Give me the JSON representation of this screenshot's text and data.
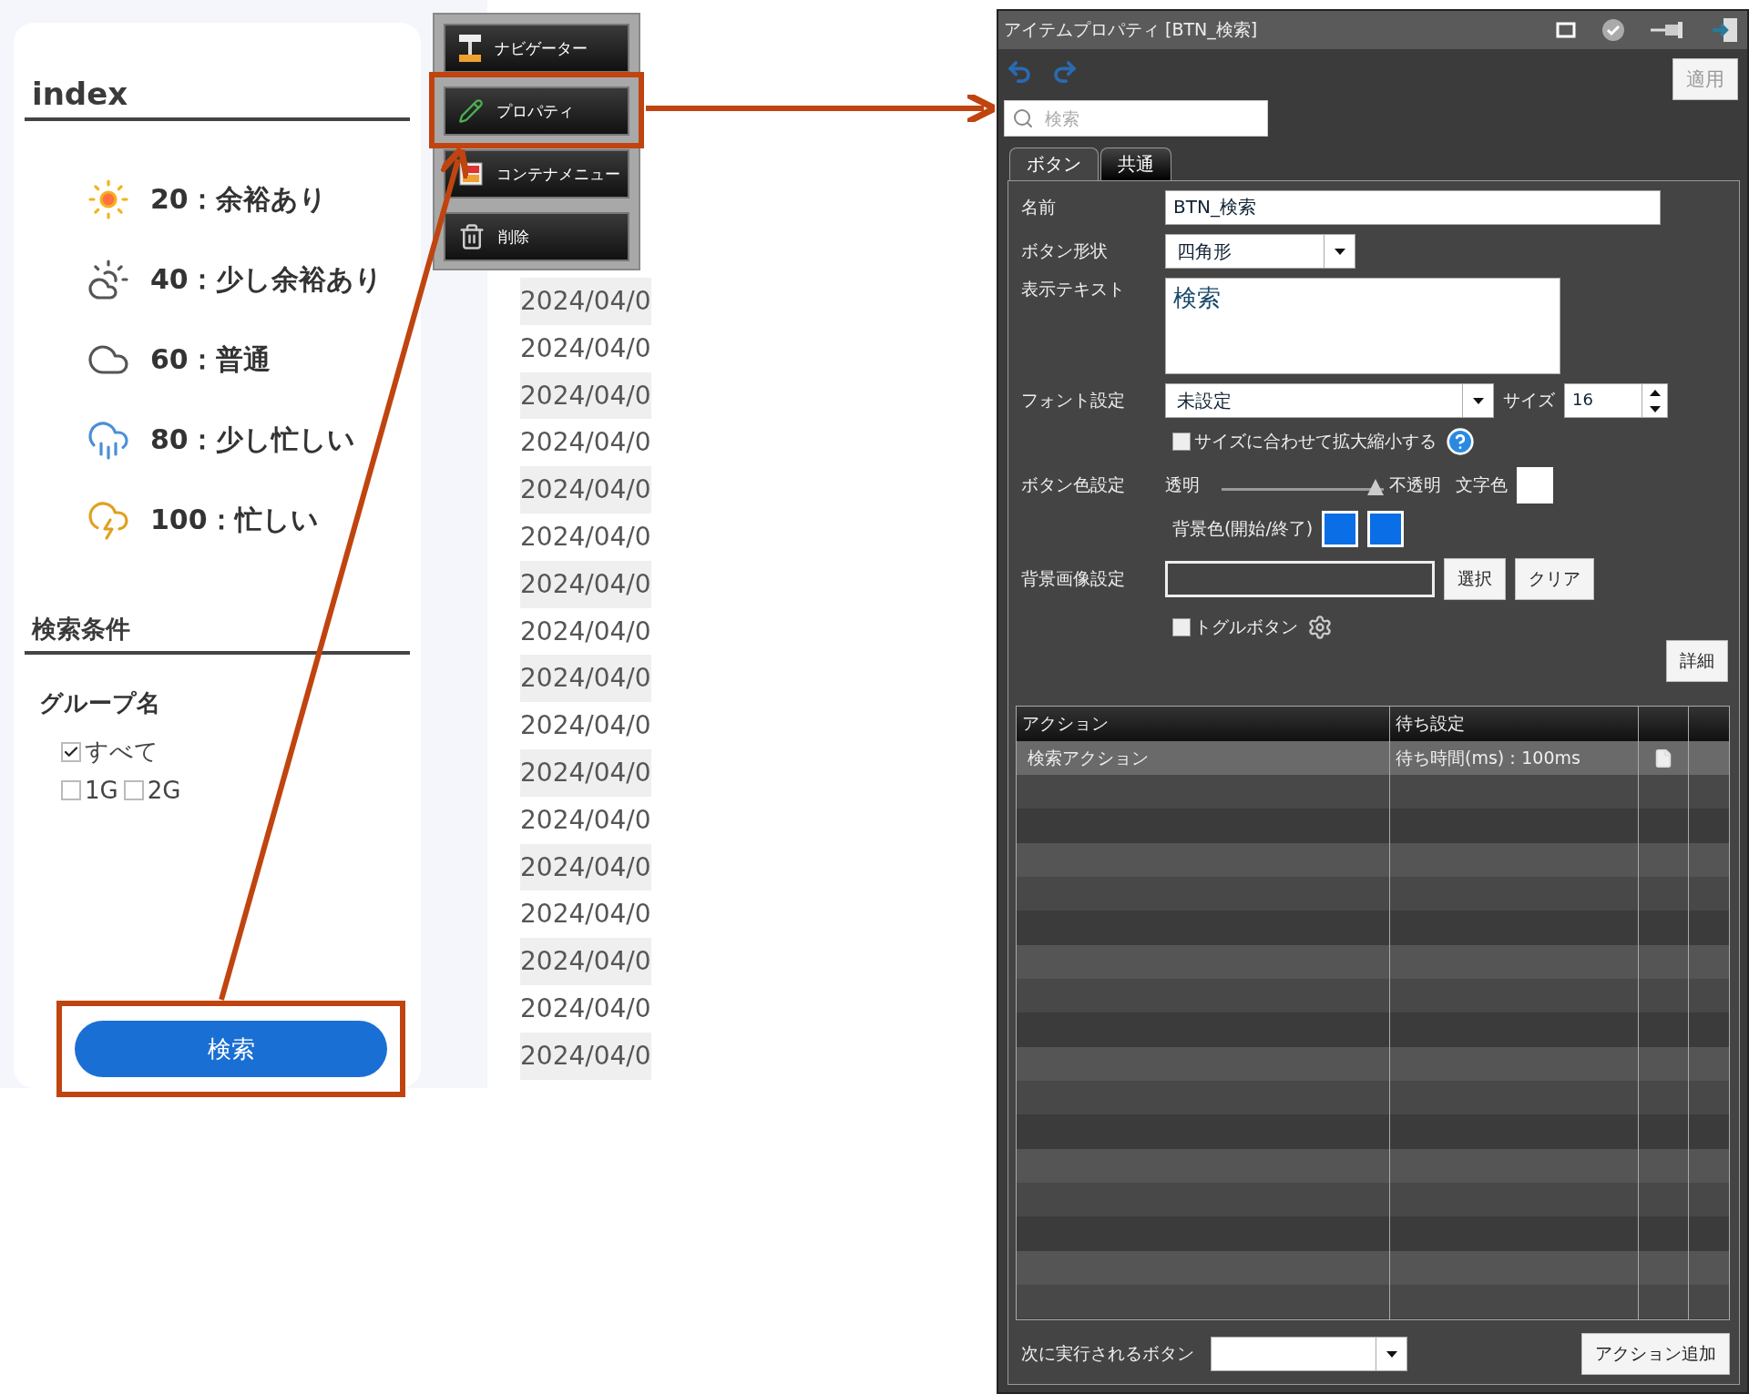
{
  "sidebar": {
    "title": "index",
    "legend": [
      {
        "kind": "sun",
        "label": "20：余裕あり"
      },
      {
        "kind": "sun-cloud",
        "label": "40：少し余裕あり"
      },
      {
        "kind": "cloud",
        "label": "60：普通"
      },
      {
        "kind": "rain",
        "label": "80：少し忙しい"
      },
      {
        "kind": "storm",
        "label": "100：忙しい"
      }
    ],
    "section_title": "検索条件",
    "group_label": "グループ名",
    "checkboxes": [
      {
        "label": "すべて",
        "checked": true
      },
      {
        "label": "1G",
        "checked": false
      },
      {
        "label": "2G",
        "checked": false
      }
    ],
    "search_button": {
      "label": "検索",
      "highlighted": true
    }
  },
  "date_column": {
    "rows": [
      "2024/04/0",
      "2024/04/0",
      "2024/04/0",
      "2024/04/0",
      "2024/04/0",
      "2024/04/0",
      "2024/04/0",
      "2024/04/0",
      "2024/04/0",
      "2024/04/0",
      "2024/04/0",
      "2024/04/0",
      "2024/04/0",
      "2024/04/0",
      "2024/04/0",
      "2024/04/0",
      "2024/04/0"
    ]
  },
  "context_menu": {
    "items": [
      {
        "kind": "navigator",
        "label": "ナビゲーター",
        "highlighted": false
      },
      {
        "kind": "pencil",
        "label": "プロパティ",
        "highlighted": true
      },
      {
        "kind": "container",
        "label": "コンテナメニュー",
        "highlighted": false
      },
      {
        "kind": "trash",
        "label": "削除",
        "highlighted": false
      }
    ]
  },
  "property_window": {
    "title": "アイテムプロパティ [BTN_検索]",
    "apply_button": "適用",
    "search": {
      "placeholder": "検索"
    },
    "tabs": [
      {
        "label": "ボタン",
        "selected": true
      },
      {
        "label": "共通",
        "selected": false
      }
    ],
    "name": {
      "label": "名前",
      "value": "BTN_検索"
    },
    "shape": {
      "label": "ボタン形状",
      "value": "四角形"
    },
    "display_text": {
      "label": "表示テキスト",
      "value": "検索"
    },
    "font": {
      "label": "フォント設定",
      "value": "未設定",
      "size_label": "サイズ",
      "size": "16"
    },
    "autoscale": {
      "label": "サイズに合わせて拡大縮小する",
      "checked": false
    },
    "button_color": {
      "label": "ボタン色設定",
      "min_label": "透明",
      "max_label": "不透明",
      "level": 1.0,
      "text_color_label": "文字色",
      "text_color_swatch": {
        "color": "#ffffff"
      },
      "background_label": "背景色(開始/終了)",
      "background_colors": [
        {
          "color": "#0a6ee6"
        },
        {
          "color": "#0a6ee6"
        }
      ]
    },
    "background_image": {
      "label": "背景画像設定",
      "select_button": "選択",
      "clear_button": "クリア"
    },
    "toggle": {
      "label": "トグルボタン",
      "checked": false
    },
    "detail_button": "詳細",
    "actions": {
      "columns": [
        "アクション",
        "待ち設定"
      ],
      "rows": [
        {
          "action": "検索アクション",
          "wait": "待ち時間(ms)：100ms",
          "selected": true
        }
      ]
    },
    "next_button": {
      "label": "次に実行されるボタン"
    },
    "add_action_button": "アクション追加"
  }
}
